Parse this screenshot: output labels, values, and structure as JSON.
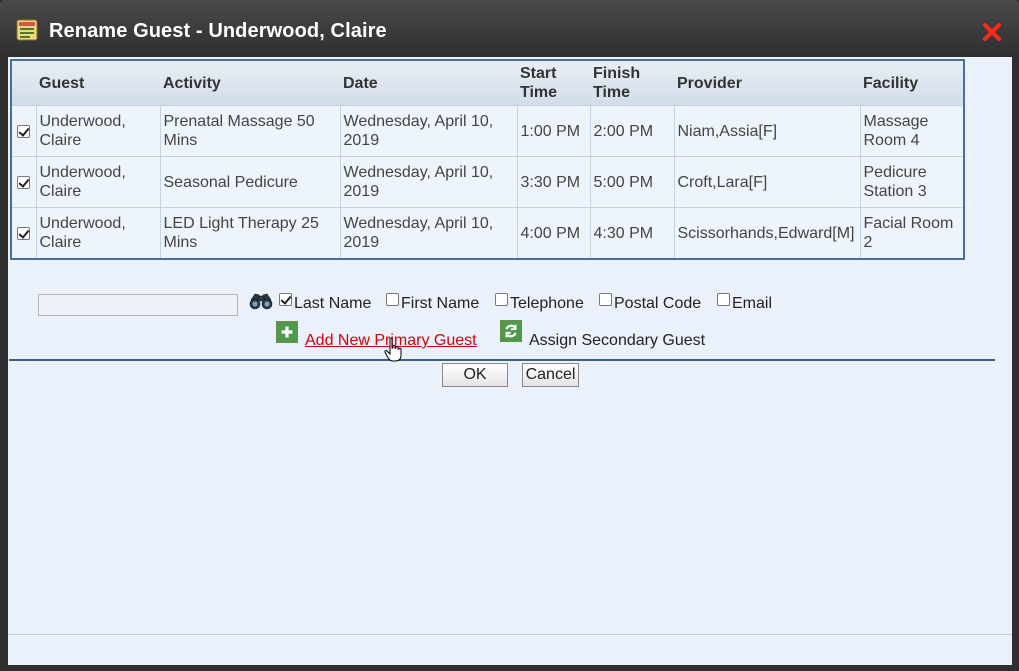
{
  "dialog": {
    "title": "Rename Guest - Underwood, Claire"
  },
  "table": {
    "headers": {
      "guest": "Guest",
      "activity": "Activity",
      "date": "Date",
      "start": "Start Time",
      "finish": "Finish Time",
      "provider": "Provider",
      "facility": "Facility"
    },
    "rows": [
      {
        "checked": true,
        "guest": "Underwood, Claire",
        "activity": "Prenatal Massage 50 Mins",
        "date": "Wednesday, April 10, 2019",
        "start": "1:00 PM",
        "finish": "2:00 PM",
        "provider": "Niam,Assia[F]",
        "facility": "Massage Room 4"
      },
      {
        "checked": true,
        "guest": "Underwood, Claire",
        "activity": "Seasonal Pedicure",
        "date": "Wednesday, April 10, 2019",
        "start": "3:30 PM",
        "finish": "5:00 PM",
        "provider": "Croft,Lara[F]",
        "facility": "Pedicure Station 3"
      },
      {
        "checked": true,
        "guest": "Underwood, Claire",
        "activity": "LED Light Therapy 25 Mins",
        "date": "Wednesday, April 10, 2019",
        "start": "4:00 PM",
        "finish": "4:30 PM",
        "provider": "Scissorhands,Edward[M]",
        "facility": "Facial Room 2"
      }
    ]
  },
  "search": {
    "value": "",
    "options": [
      {
        "label": "Last Name",
        "checked": true
      },
      {
        "label": "First Name",
        "checked": false
      },
      {
        "label": "Telephone",
        "checked": false
      },
      {
        "label": "Postal Code",
        "checked": false
      },
      {
        "label": "Email",
        "checked": false
      }
    ]
  },
  "actions": {
    "add_primary": "Add New Primary Guest",
    "assign_secondary": "Assign Secondary Guest"
  },
  "buttons": {
    "ok": "OK",
    "cancel": "Cancel"
  },
  "colors": {
    "link": "#d8000c",
    "header_border": "#4a6f96",
    "close": "#ff2a1a"
  },
  "icons": {
    "title": "window-list-icon",
    "close": "close-icon",
    "search": "binoculars-icon",
    "add": "plus-icon",
    "assign": "refresh-icon",
    "cursor": "hand-pointer-icon"
  }
}
